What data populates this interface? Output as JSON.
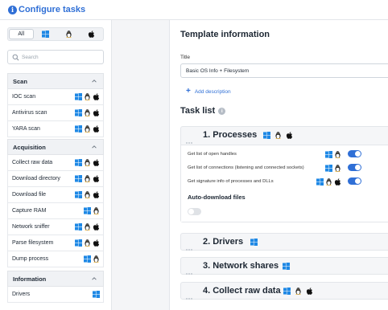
{
  "header": {
    "title": "Configure tasks",
    "icon": "info-icon"
  },
  "os_filter": {
    "all_label": "All",
    "options": [
      "windows-icon",
      "linux-icon",
      "apple-icon"
    ]
  },
  "search": {
    "placeholder": "Search"
  },
  "groups": {
    "scan": "Scan",
    "acquisition": "Acquisition",
    "information": "Information"
  },
  "tasks": {
    "ioc_scan": "IOC scan",
    "antivirus_scan": "Antivirus scan",
    "yara_scan": "YARA scan",
    "collect_raw_data": "Collect raw data",
    "download_directory": "Download directory",
    "download_file": "Download file",
    "capture_ram": "Capture RAM",
    "network_sniffer": "Network sniffer",
    "parse_filesystem": "Parse filesystem",
    "dump_process": "Dump process",
    "drivers": "Drivers"
  },
  "template": {
    "section_title": "Template information",
    "title_label": "Title",
    "title_value": "Basic OS Info + Filesystem",
    "add_description": "Add description"
  },
  "task_list": {
    "title": "Task list",
    "cards": {
      "processes": {
        "name": "1. Processes",
        "subtasks": [
          {
            "label": "Get list of open handles",
            "enabled": true
          },
          {
            "label": "Get list of connections (listening and connected sockets)",
            "enabled": true
          },
          {
            "label": "Get signature info of processes and DLLs",
            "enabled": true
          }
        ],
        "auto_download_label": "Auto-download files",
        "auto_download_enabled": false
      },
      "drivers": {
        "name": "2. Drivers"
      },
      "network_shares": {
        "name": "3. Network shares"
      },
      "collect_raw_data": {
        "name": "4. Collect raw data"
      }
    }
  },
  "colors": {
    "accent": "#2f6fd6",
    "windows": "#1e88e5",
    "text": "#1d2733"
  }
}
